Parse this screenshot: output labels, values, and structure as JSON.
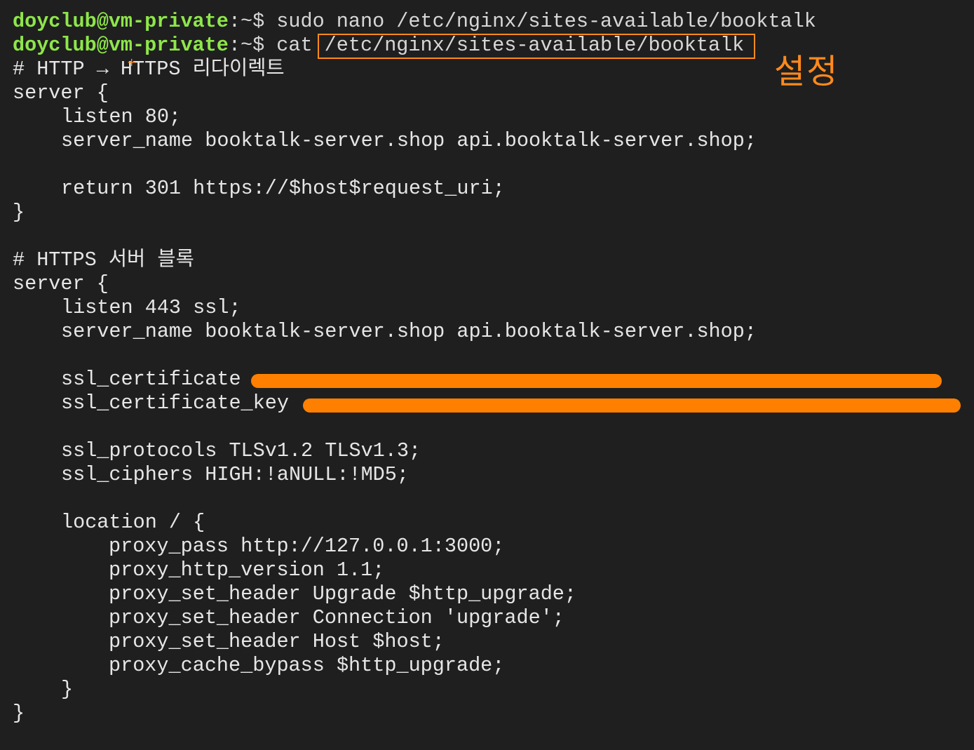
{
  "prompt": {
    "user_host": "doyclub@vm-private",
    "suffix": ":~$"
  },
  "commands": [
    " sudo nano /etc/nginx/sites-available/booktalk",
    " cat /etc/nginx/sites-available/booktalk"
  ],
  "annotation": {
    "label": "설정",
    "color": "#ff8a1c"
  },
  "config_lines": {
    "c01": "# HTTP → HTTPS 리다이렉트",
    "c02": "server {",
    "c03": "listen 80;",
    "c04": "server_name booktalk-server.shop api.booktalk-server.shop;",
    "c05": "",
    "c06": "return 301 https://$host$request_uri;",
    "c07": "}",
    "c08": "",
    "c09": "# HTTPS 서버 블록",
    "c10": "server {",
    "c11": "listen 443 ssl;",
    "c12": "server_name booktalk-server.shop api.booktalk-server.shop;",
    "c13": "",
    "c14": "ssl_certificate",
    "c15": "ssl_certificate_key",
    "c16": "",
    "c17": "ssl_protocols TLSv1.2 TLSv1.3;",
    "c18": "ssl_ciphers HIGH:!aNULL:!MD5;",
    "c19": "",
    "c20": "location / {",
    "c21": "proxy_pass http://127.0.0.1:3000;",
    "c22": "proxy_http_version 1.1;",
    "c23": "proxy_set_header Upgrade $http_upgrade;",
    "c24": "proxy_set_header Connection 'upgrade';",
    "c25": "proxy_set_header Host $host;",
    "c26": "proxy_cache_bypass $http_upgrade;",
    "c27": "}",
    "c28": "}"
  },
  "colors": {
    "background": "#1f1f1f",
    "prompt_user": "#8ee64a",
    "text": "#e6e6e6",
    "accent": "#ff8a1c",
    "redaction": "#ff8000"
  }
}
